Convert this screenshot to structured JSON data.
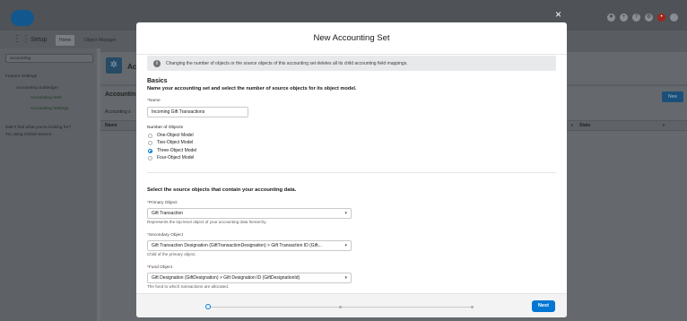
{
  "background": {
    "app_title": "Setup",
    "tabs": [
      "Home",
      "Object Manager"
    ],
    "sidebar": {
      "search_value": "accounting",
      "items": [
        "Feature Settings",
        "Accounting Subledger",
        "Accounting Sets",
        "Accounting Settings"
      ],
      "hint_line1": "Didn't find what you're looking for?",
      "hint_line2": "Try using Global Search."
    },
    "page_title_abbrev": "Ac",
    "list_title": "Accountin",
    "list_subtitle": "Accounting s",
    "col_name": "Name",
    "col_state": "State",
    "new_button": "New"
  },
  "modal": {
    "title": "New Accounting Set",
    "info_text": "Changing the number of objects or the source objects of this accounting set deletes all its child accounting field mappings.",
    "basics_heading": "Basics",
    "basics_sub": "Name your accounting set and select the number of source objects for its object model.",
    "name_label": "Name",
    "name_value": "Incoming Gift Transactions",
    "objects_label": "Number of Objects",
    "options": [
      "One-Object Model",
      "Two-Object Model",
      "Three-Object Model",
      "Four-Object Model"
    ],
    "selected_option": "Three-Object Model",
    "select_heading": "Select the source objects that contain your accounting data.",
    "primary_label": "Primary Object",
    "primary_value": "Gift Transaction",
    "primary_help": "Represents the top-level object of your accounting data hierarchy.",
    "secondary_label": "Secondary Object",
    "secondary_value": "Gift Transaction Designation (GiftTransactionDesignation) > Gift Transaction ID (Gift...",
    "secondary_help": "Child of the primary object.",
    "fund_label": "Fund Object",
    "fund_value": "Gift Designation (GiftDesignation) > Gift Designation ID (GiftDesignationId)",
    "fund_help": "The fund to which transactions are allocated.",
    "next_label": "Next",
    "close_glyph": "×"
  },
  "colors": {
    "brand": "#0176d3",
    "overlay": "#6b6f74"
  }
}
